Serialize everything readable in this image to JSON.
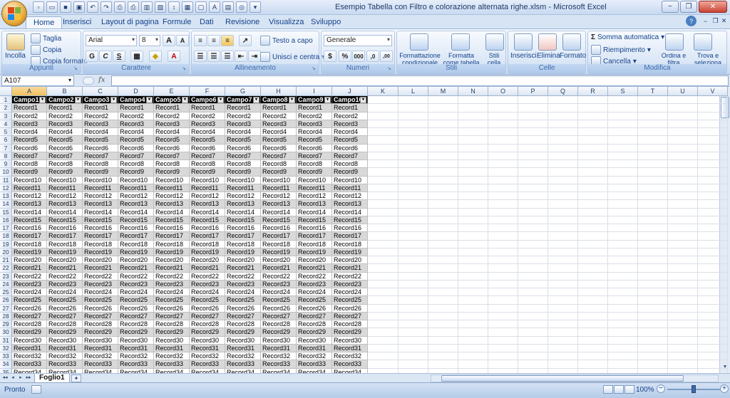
{
  "window": {
    "title": "Esempio Tabella con Filtro e colorazione alternata righe.xlsm - Microsoft Excel",
    "minimize": "−",
    "restore": "❐",
    "close": "✕"
  },
  "tabs": [
    {
      "label": "Home",
      "active": true
    },
    {
      "label": "Inserisci"
    },
    {
      "label": "Layout di pagina"
    },
    {
      "label": "Formule"
    },
    {
      "label": "Dati"
    },
    {
      "label": "Revisione"
    },
    {
      "label": "Visualizza"
    },
    {
      "label": "Sviluppo"
    }
  ],
  "help": {
    "question": "?"
  },
  "ribbon": {
    "clipboard": {
      "label": "Appunti",
      "paste": "Incolla",
      "cut": "Taglia",
      "copy": "Copia",
      "format_painter": "Copia formato"
    },
    "font": {
      "label": "Carattere",
      "name": "Arial",
      "size": "8",
      "grow": "A",
      "shrink": "A",
      "bold": "G",
      "italic": "C",
      "underline": "S"
    },
    "alignment": {
      "label": "Allineamento",
      "wrap": "Testo a capo",
      "merge": "Unisci e centra"
    },
    "number": {
      "label": "Numeri",
      "format": "Generale",
      "currency": "$",
      "percent": "%",
      "thousands": "000",
      "inc_dec": ",0",
      "dec_dec": ",00"
    },
    "styles": {
      "label": "Stili",
      "conditional": "Formattazione condizionale",
      "as_table": "Formatta come tabella",
      "cell_styles": "Stili cella"
    },
    "cells": {
      "label": "Celle",
      "insert": "Inserisci",
      "delete": "Elimina",
      "format": "Formato"
    },
    "editing": {
      "label": "Modifica",
      "autosum": "Somma automatica",
      "fill": "Riempimento",
      "clear": "Cancella",
      "sort_filter": "Ordina e filtra",
      "find_select": "Trova e seleziona"
    }
  },
  "formula_bar": {
    "name_box": "A107",
    "fx": "fx",
    "formula": ""
  },
  "columns": [
    "A",
    "B",
    "C",
    "D",
    "E",
    "F",
    "G",
    "H",
    "I",
    "J",
    "K",
    "L",
    "M",
    "N",
    "O",
    "P",
    "Q",
    "R",
    "S",
    "T",
    "U",
    "V"
  ],
  "selected_column": "A",
  "table": {
    "headers": [
      "Campo1",
      "Campo2",
      "Campo3",
      "Campo4",
      "Campo5",
      "Campo6",
      "Campo7",
      "Campo8",
      "Campo9",
      "Campo10"
    ],
    "record_prefix": "Record",
    "visible_record_count": 34,
    "filter_icon": "▾"
  },
  "row_numbers_start": 1,
  "visible_rows": 35,
  "sheet": {
    "tab": "Foglio1",
    "nav_first": "◂◂",
    "nav_prev": "◂",
    "nav_next": "▸",
    "nav_last": "▸▸",
    "new_sheet": "✦"
  },
  "status": {
    "ready": "Pronto",
    "zoom": "100%",
    "zoom_value": 1.0
  }
}
